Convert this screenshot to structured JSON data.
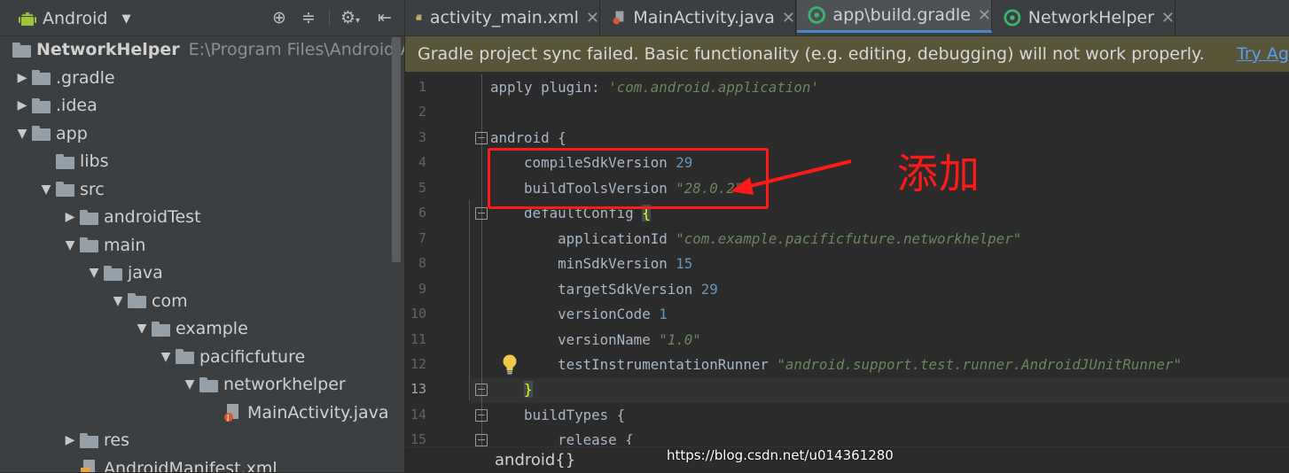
{
  "project_panel": {
    "view_selector": "Android",
    "tree": [
      {
        "label": "NetworkHelper",
        "path": "E:\\Program Files\\Android\\Andr",
        "depth": 0,
        "kind": "project",
        "expanded": true
      },
      {
        "label": ".gradle",
        "depth": 0,
        "kind": "folder",
        "expanded": false
      },
      {
        "label": ".idea",
        "depth": 0,
        "kind": "folder",
        "expanded": false
      },
      {
        "label": "app",
        "depth": 0,
        "kind": "folder",
        "expanded": true
      },
      {
        "label": "libs",
        "depth": 1,
        "kind": "folder",
        "expanded": null
      },
      {
        "label": "src",
        "depth": 1,
        "kind": "folder",
        "expanded": true
      },
      {
        "label": "androidTest",
        "depth": 2,
        "kind": "folder",
        "expanded": false
      },
      {
        "label": "main",
        "depth": 2,
        "kind": "folder",
        "expanded": true
      },
      {
        "label": "java",
        "depth": 3,
        "kind": "folder",
        "expanded": true
      },
      {
        "label": "com",
        "depth": 4,
        "kind": "folder",
        "expanded": true
      },
      {
        "label": "example",
        "depth": 5,
        "kind": "folder",
        "expanded": true
      },
      {
        "label": "pacificfuture",
        "depth": 6,
        "kind": "folder",
        "expanded": true
      },
      {
        "label": "networkhelper",
        "depth": 7,
        "kind": "folder",
        "expanded": true
      },
      {
        "label": "MainActivity.java",
        "depth": 8,
        "kind": "java-file",
        "expanded": null
      },
      {
        "label": "res",
        "depth": 2,
        "kind": "folder",
        "expanded": false
      },
      {
        "label": "AndroidManifest.xml",
        "depth": 2,
        "kind": "xml-file",
        "expanded": null
      }
    ]
  },
  "editor": {
    "tabs": [
      {
        "label": "activity_main.xml",
        "icon": "xml-file-icon",
        "active": false
      },
      {
        "label": "MainActivity.java",
        "icon": "java-file-icon",
        "active": false
      },
      {
        "label": "app\\build.gradle",
        "icon": "gradle-file-icon",
        "active": true
      },
      {
        "label": "NetworkHelper",
        "icon": "gradle-file-icon",
        "active": false
      }
    ],
    "notification": {
      "text": "Gradle project sync failed. Basic functionality (e.g. editing, debugging) will not work properly.",
      "link": "Try Ag"
    },
    "line_numbers": [
      "1",
      "2",
      "3",
      "4",
      "5",
      "6",
      "7",
      "8",
      "9",
      "10",
      "11",
      "12",
      "13",
      "14",
      "15"
    ],
    "code": [
      {
        "parts": [
          {
            "t": "apply ",
            "c": "plain"
          },
          {
            "t": "plugin",
            "c": "plain"
          },
          {
            "t": ": ",
            "c": "plain"
          },
          {
            "t": "'com.android.application'",
            "c": "str"
          }
        ]
      },
      {
        "parts": []
      },
      {
        "parts": [
          {
            "t": "android {",
            "c": "plain"
          }
        ]
      },
      {
        "parts": [
          {
            "t": "    compileSdkVersion ",
            "c": "plain"
          },
          {
            "t": "29",
            "c": "num"
          }
        ]
      },
      {
        "parts": [
          {
            "t": "    buildToolsVersion ",
            "c": "plain"
          },
          {
            "t": "\"28.0.2\"",
            "c": "str"
          }
        ]
      },
      {
        "parts": [
          {
            "t": "    defaultConfig ",
            "c": "plain"
          },
          {
            "t": "{",
            "c": "brace-hl"
          }
        ]
      },
      {
        "parts": [
          {
            "t": "        applicationId ",
            "c": "plain"
          },
          {
            "t": "\"com.example.pacificfuture.networkhelper\"",
            "c": "str"
          }
        ]
      },
      {
        "parts": [
          {
            "t": "        minSdkVersion ",
            "c": "plain"
          },
          {
            "t": "15",
            "c": "num"
          }
        ]
      },
      {
        "parts": [
          {
            "t": "        targetSdkVersion ",
            "c": "plain"
          },
          {
            "t": "29",
            "c": "num"
          }
        ]
      },
      {
        "parts": [
          {
            "t": "        versionCode ",
            "c": "plain"
          },
          {
            "t": "1",
            "c": "num"
          }
        ]
      },
      {
        "parts": [
          {
            "t": "        versionName ",
            "c": "plain"
          },
          {
            "t": "\"1.0\"",
            "c": "str"
          }
        ]
      },
      {
        "parts": [
          {
            "t": "        testInstrumentationRunner ",
            "c": "plain"
          },
          {
            "t": "\"android.support.test.runner.AndroidJUnitRunner\"",
            "c": "str"
          }
        ]
      },
      {
        "parts": [
          {
            "t": "    ",
            "c": "plain"
          },
          {
            "t": "}",
            "c": "brace-hl"
          }
        ]
      },
      {
        "parts": [
          {
            "t": "    buildTypes {",
            "c": "plain"
          }
        ]
      },
      {
        "parts": [
          {
            "t": "        release {",
            "c": "plain"
          }
        ]
      }
    ],
    "current_line": 13,
    "breadcrumb": "android{}"
  },
  "annotation": {
    "label": "添加",
    "color": "#ff1a1a"
  },
  "watermark": "https://blog.csdn.net/u014361280",
  "colors": {
    "panel_bg": "#3c3f41",
    "editor_bg": "#2b2b2b",
    "notification_bg": "#595539",
    "string": "#6a8759",
    "number": "#6897bb",
    "active_tab_underline": "#4a88c7"
  }
}
